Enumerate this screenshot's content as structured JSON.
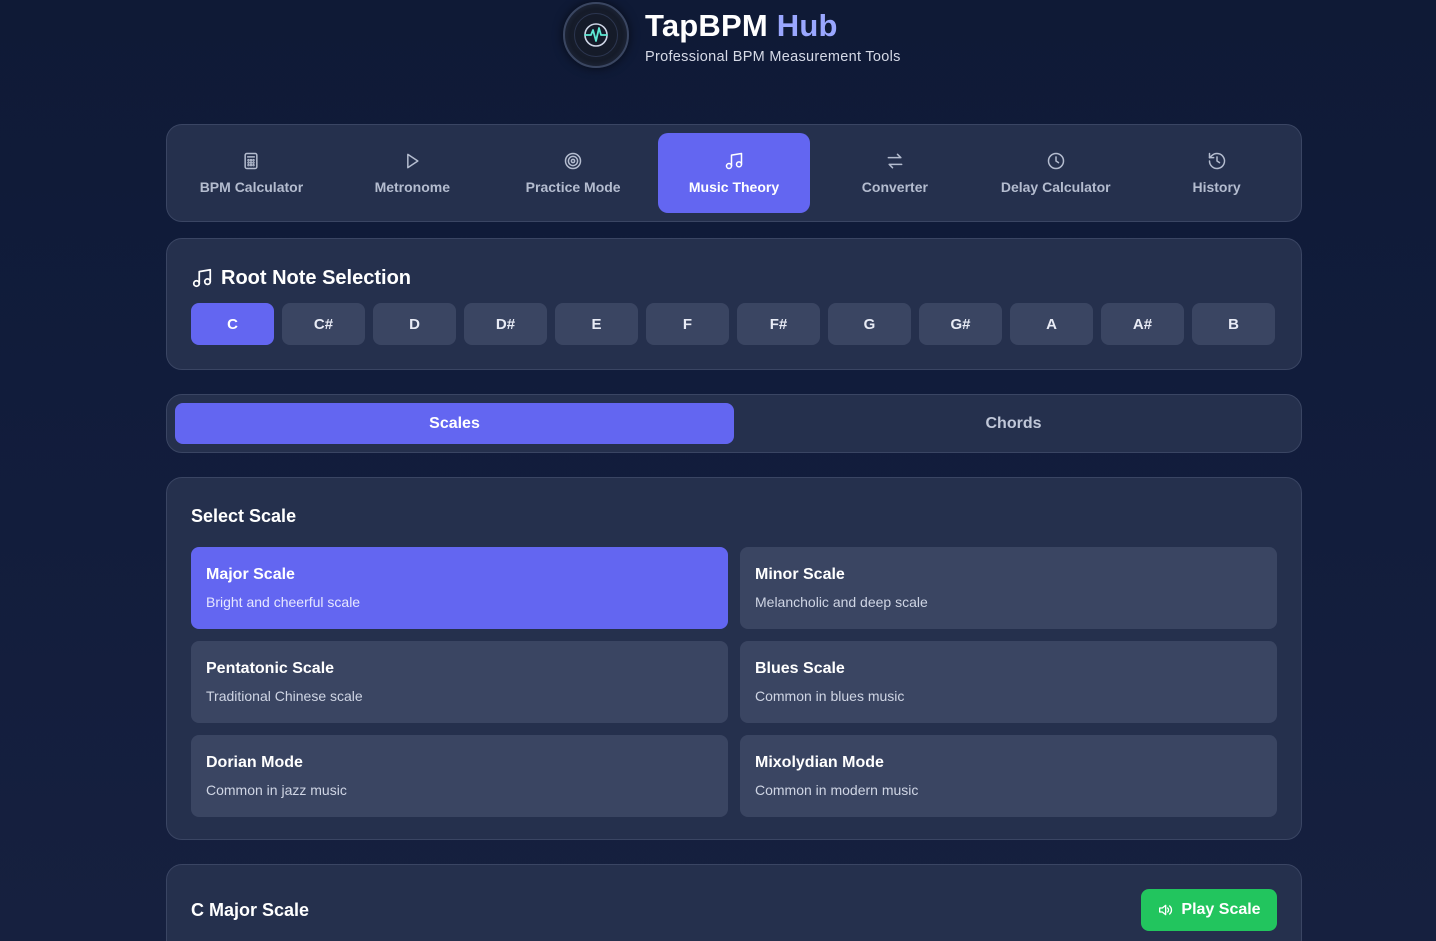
{
  "header": {
    "title_main": "TapBPM",
    "title_accent": "Hub",
    "subtitle": "Professional BPM Measurement Tools",
    "logo_icon": "pulse-icon"
  },
  "nav": {
    "items": [
      {
        "label": "BPM Calculator",
        "icon": "calculator-icon"
      },
      {
        "label": "Metronome",
        "icon": "play-icon"
      },
      {
        "label": "Practice Mode",
        "icon": "target-icon"
      },
      {
        "label": "Music Theory",
        "icon": "music-note-icon",
        "active": true
      },
      {
        "label": "Converter",
        "icon": "swap-icon"
      },
      {
        "label": "Delay Calculator",
        "icon": "clock-icon"
      },
      {
        "label": "History",
        "icon": "history-icon"
      }
    ]
  },
  "root_note": {
    "title": "Root Note Selection",
    "notes": [
      "C",
      "C#",
      "D",
      "D#",
      "E",
      "F",
      "F#",
      "G",
      "G#",
      "A",
      "A#",
      "B"
    ],
    "selected": "C"
  },
  "mode_toggle": {
    "scales_label": "Scales",
    "chords_label": "Chords",
    "selected": "Scales"
  },
  "scale_select": {
    "heading": "Select Scale",
    "scales": [
      {
        "name": "Major Scale",
        "desc": "Bright and cheerful scale",
        "active": true
      },
      {
        "name": "Minor Scale",
        "desc": "Melancholic and deep scale"
      },
      {
        "name": "Pentatonic Scale",
        "desc": "Traditional Chinese scale"
      },
      {
        "name": "Blues Scale",
        "desc": "Common in blues music"
      },
      {
        "name": "Dorian Mode",
        "desc": "Common in jazz music"
      },
      {
        "name": "Mixolydian Mode",
        "desc": "Common in modern music"
      }
    ]
  },
  "result": {
    "title": "C Major Scale",
    "play_label": "Play Scale"
  },
  "colors": {
    "accent": "#6366f1",
    "play": "#22c55e",
    "panel": "#25304d"
  }
}
